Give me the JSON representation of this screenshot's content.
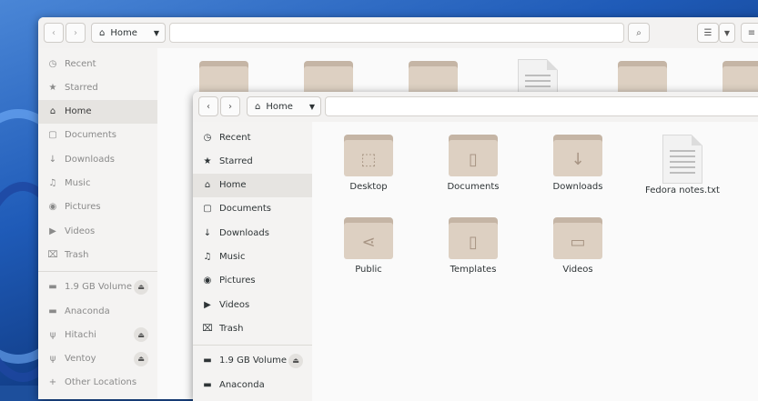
{
  "back_window": {
    "path_label": "Home",
    "sidebar": [
      {
        "label": "Recent",
        "icon": "clock-icon",
        "glyph": "◷"
      },
      {
        "label": "Starred",
        "icon": "star-icon",
        "glyph": "★"
      },
      {
        "label": "Home",
        "icon": "home-icon",
        "glyph": "⌂"
      },
      {
        "label": "Documents",
        "icon": "document-icon",
        "glyph": "▢"
      },
      {
        "label": "Downloads",
        "icon": "download-icon",
        "glyph": "↓"
      },
      {
        "label": "Music",
        "icon": "music-icon",
        "glyph": "♫"
      },
      {
        "label": "Pictures",
        "icon": "camera-icon",
        "glyph": "◉"
      },
      {
        "label": "Videos",
        "icon": "video-icon",
        "glyph": "▶"
      },
      {
        "label": "Trash",
        "icon": "trash-icon",
        "glyph": "⌧"
      },
      {
        "label": "1.9 GB Volume",
        "icon": "drive-icon",
        "glyph": "▬"
      },
      {
        "label": "Anaconda",
        "icon": "drive-icon",
        "glyph": "▬"
      },
      {
        "label": "Hitachi",
        "icon": "usb-icon",
        "glyph": "ψ"
      },
      {
        "label": "Ventoy",
        "icon": "usb-icon",
        "glyph": "ψ"
      },
      {
        "label": "Other Locations",
        "icon": "plus-icon",
        "glyph": "+"
      }
    ]
  },
  "front_window": {
    "path_label": "Home",
    "sidebar": [
      {
        "label": "Recent",
        "icon": "clock-icon",
        "glyph": "◷"
      },
      {
        "label": "Starred",
        "icon": "star-icon",
        "glyph": "★"
      },
      {
        "label": "Home",
        "icon": "home-icon",
        "glyph": "⌂"
      },
      {
        "label": "Documents",
        "icon": "document-icon",
        "glyph": "▢"
      },
      {
        "label": "Downloads",
        "icon": "download-icon",
        "glyph": "↓"
      },
      {
        "label": "Music",
        "icon": "music-icon",
        "glyph": "♫"
      },
      {
        "label": "Pictures",
        "icon": "camera-icon",
        "glyph": "◉"
      },
      {
        "label": "Videos",
        "icon": "video-icon",
        "glyph": "▶"
      },
      {
        "label": "Trash",
        "icon": "trash-icon",
        "glyph": "⌧"
      },
      {
        "label": "1.9 GB Volume",
        "icon": "drive-icon",
        "glyph": "▬"
      },
      {
        "label": "Anaconda",
        "icon": "drive-icon",
        "glyph": "▬"
      }
    ],
    "files": [
      {
        "label": "Desktop",
        "kind": "folder",
        "icon": "desktop-folder-icon",
        "glyph": "⬚"
      },
      {
        "label": "Documents",
        "kind": "folder",
        "icon": "documents-folder-icon",
        "glyph": "▯"
      },
      {
        "label": "Downloads",
        "kind": "folder",
        "icon": "downloads-folder-icon",
        "glyph": "↓"
      },
      {
        "label": "Fedora notes.txt",
        "kind": "text",
        "icon": "text-file-icon",
        "glyph": ""
      },
      {
        "label": "Public",
        "kind": "folder",
        "icon": "public-folder-icon",
        "glyph": "⋖"
      },
      {
        "label": "Templates",
        "kind": "folder",
        "icon": "templates-folder-icon",
        "glyph": "▯"
      },
      {
        "label": "Videos",
        "kind": "folder",
        "icon": "videos-folder-icon",
        "glyph": "▭"
      }
    ]
  },
  "colors": {
    "accent": "#c5b5a5",
    "folder": "#ddd0c2",
    "background": "#1d4f9c"
  }
}
